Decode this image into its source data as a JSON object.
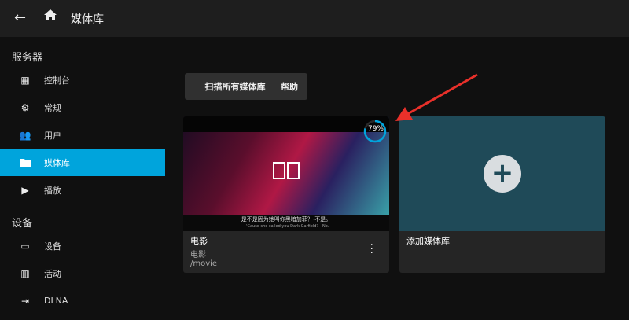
{
  "header": {
    "title": "媒体库"
  },
  "sidebar": {
    "sections": [
      {
        "label": "服务器",
        "items": [
          {
            "label": "控制台"
          },
          {
            "label": "常规"
          },
          {
            "label": "用户"
          },
          {
            "label": "媒体库"
          },
          {
            "label": "播放"
          }
        ]
      },
      {
        "label": "设备",
        "items": [
          {
            "label": "设备"
          },
          {
            "label": "活动"
          },
          {
            "label": "DLNA"
          }
        ]
      }
    ]
  },
  "toolbar": {
    "scan_label": "扫描所有媒体库",
    "help_label": "帮助"
  },
  "libraries": [
    {
      "title": "电影",
      "type": "电影",
      "path": "/movie",
      "progress_percent": 79,
      "progress_label": "79%",
      "subtitle_zh": "是不是因为她叫你黑暗加菲？-不是。",
      "subtitle_en": "- 'Cause she called you Dark Garfield? - No."
    }
  ],
  "add_card": {
    "label": "添加媒体库"
  },
  "colors": {
    "accent": "#00a4dc",
    "annotation_arrow": "#e8302a"
  }
}
